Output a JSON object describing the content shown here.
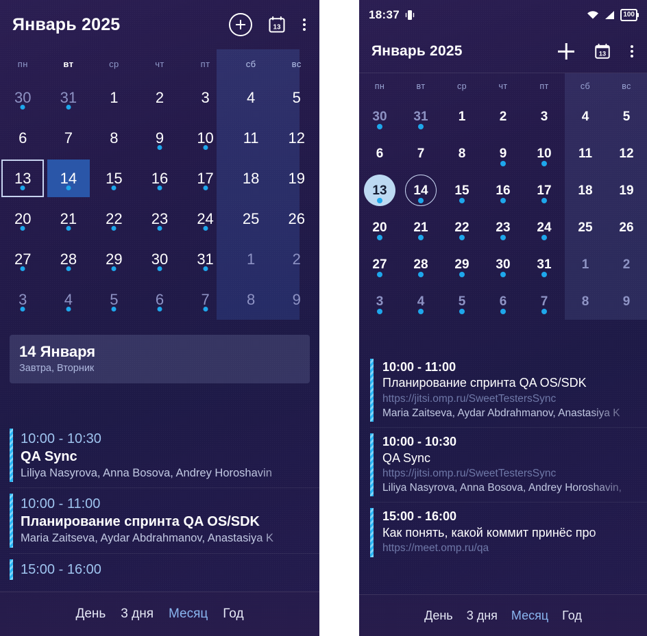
{
  "colors": {
    "background": "#241a4a",
    "accent": "#29b6f6",
    "event_dot": "#1ea7ec",
    "selected_fill": "#2a56a8",
    "today_circle": "#bcd9f2",
    "nav_active": "#8ab6f0"
  },
  "status_bar": {
    "time": "18:37",
    "vibrate_icon": "vibrate-icon",
    "wifi_icon": "wifi-icon",
    "signal_icon": "cellular-signal-icon",
    "battery_level": "100"
  },
  "app_bar": {
    "title": "Январь 2025",
    "add_icon": "plus-icon",
    "today_icon": "calendar-today-icon",
    "today_icon_label": "13",
    "overflow_icon": "more-vertical-icon"
  },
  "weekdays": [
    {
      "label": "пн",
      "weekend": false
    },
    {
      "label": "вт",
      "weekend": false
    },
    {
      "label": "ср",
      "weekend": false
    },
    {
      "label": "чт",
      "weekend": false
    },
    {
      "label": "пт",
      "weekend": false
    },
    {
      "label": "сб",
      "weekend": true
    },
    {
      "label": "вс",
      "weekend": true
    }
  ],
  "calendar": {
    "weeks": [
      [
        {
          "num": "30",
          "dim": true,
          "dot": true,
          "today": false,
          "selected": false
        },
        {
          "num": "31",
          "dim": true,
          "dot": true,
          "today": false,
          "selected": false
        },
        {
          "num": "1",
          "dim": false,
          "dot": false,
          "today": false,
          "selected": false
        },
        {
          "num": "2",
          "dim": false,
          "dot": false,
          "today": false,
          "selected": false
        },
        {
          "num": "3",
          "dim": false,
          "dot": false,
          "today": false,
          "selected": false
        },
        {
          "num": "4",
          "dim": false,
          "dot": false,
          "today": false,
          "selected": false
        },
        {
          "num": "5",
          "dim": false,
          "dot": false,
          "today": false,
          "selected": false
        }
      ],
      [
        {
          "num": "6",
          "dim": false,
          "dot": false,
          "today": false,
          "selected": false
        },
        {
          "num": "7",
          "dim": false,
          "dot": false,
          "today": false,
          "selected": false
        },
        {
          "num": "8",
          "dim": false,
          "dot": false,
          "today": false,
          "selected": false
        },
        {
          "num": "9",
          "dim": false,
          "dot": true,
          "today": false,
          "selected": false
        },
        {
          "num": "10",
          "dim": false,
          "dot": true,
          "today": false,
          "selected": false
        },
        {
          "num": "11",
          "dim": false,
          "dot": false,
          "today": false,
          "selected": false
        },
        {
          "num": "12",
          "dim": false,
          "dot": false,
          "today": false,
          "selected": false
        }
      ],
      [
        {
          "num": "13",
          "dim": false,
          "dot": true,
          "today": true,
          "selected": false
        },
        {
          "num": "14",
          "dim": false,
          "dot": true,
          "today": false,
          "selected": true
        },
        {
          "num": "15",
          "dim": false,
          "dot": true,
          "today": false,
          "selected": false
        },
        {
          "num": "16",
          "dim": false,
          "dot": true,
          "today": false,
          "selected": false
        },
        {
          "num": "17",
          "dim": false,
          "dot": true,
          "today": false,
          "selected": false
        },
        {
          "num": "18",
          "dim": false,
          "dot": false,
          "today": false,
          "selected": false
        },
        {
          "num": "19",
          "dim": false,
          "dot": false,
          "today": false,
          "selected": false
        }
      ],
      [
        {
          "num": "20",
          "dim": false,
          "dot": true,
          "today": false,
          "selected": false
        },
        {
          "num": "21",
          "dim": false,
          "dot": true,
          "today": false,
          "selected": false
        },
        {
          "num": "22",
          "dim": false,
          "dot": true,
          "today": false,
          "selected": false
        },
        {
          "num": "23",
          "dim": false,
          "dot": true,
          "today": false,
          "selected": false
        },
        {
          "num": "24",
          "dim": false,
          "dot": true,
          "today": false,
          "selected": false
        },
        {
          "num": "25",
          "dim": false,
          "dot": false,
          "today": false,
          "selected": false
        },
        {
          "num": "26",
          "dim": false,
          "dot": false,
          "today": false,
          "selected": false
        }
      ],
      [
        {
          "num": "27",
          "dim": false,
          "dot": true,
          "today": false,
          "selected": false
        },
        {
          "num": "28",
          "dim": false,
          "dot": true,
          "today": false,
          "selected": false
        },
        {
          "num": "29",
          "dim": false,
          "dot": true,
          "today": false,
          "selected": false
        },
        {
          "num": "30",
          "dim": false,
          "dot": true,
          "today": false,
          "selected": false
        },
        {
          "num": "31",
          "dim": false,
          "dot": true,
          "today": false,
          "selected": false
        },
        {
          "num": "1",
          "dim": true,
          "dot": false,
          "today": false,
          "selected": false
        },
        {
          "num": "2",
          "dim": true,
          "dot": false,
          "today": false,
          "selected": false
        }
      ],
      [
        {
          "num": "3",
          "dim": true,
          "dot": true,
          "today": false,
          "selected": false
        },
        {
          "num": "4",
          "dim": true,
          "dot": true,
          "today": false,
          "selected": false
        },
        {
          "num": "5",
          "dim": true,
          "dot": true,
          "today": false,
          "selected": false
        },
        {
          "num": "6",
          "dim": true,
          "dot": true,
          "today": false,
          "selected": false
        },
        {
          "num": "7",
          "dim": true,
          "dot": true,
          "today": false,
          "selected": false
        },
        {
          "num": "8",
          "dim": true,
          "dot": false,
          "today": false,
          "selected": false
        },
        {
          "num": "9",
          "dim": true,
          "dot": false,
          "today": false,
          "selected": false
        }
      ]
    ]
  },
  "day_card": {
    "title": "14 Января",
    "subtitle": "Завтра, Вторник"
  },
  "left_events": [
    {
      "time": "10:00 - 10:30",
      "title": "QA Sync",
      "people": "Liliya Nasyrova, Anna Bosova, Andrey Horoshavin"
    },
    {
      "time": "10:00 - 11:00",
      "title": "Планирование спринта QA OS/SDK",
      "people": "Maria Zaitseva, Aydar Abdrahmanov, Anastasiya K"
    },
    {
      "time": "15:00 - 16:00",
      "title": "",
      "people": ""
    }
  ],
  "right_events": [
    {
      "time": "10:00 - 11:00",
      "title": "Планирование спринта QA OS/SDK",
      "url": "https://jitsi.omp.ru/SweetTestersSync",
      "people": "Maria Zaitseva, Aydar Abdrahmanov, Anastasiya K"
    },
    {
      "time": "10:00 - 10:30",
      "title": "QA Sync",
      "url": "https://jitsi.omp.ru/SweetTestersSync",
      "people": "Liliya Nasyrova, Anna Bosova, Andrey Horoshavin,"
    },
    {
      "time": "15:00 - 16:00",
      "title": "Как понять, какой коммит принёс про",
      "url": "https://meet.omp.ru/qa",
      "people": ""
    }
  ],
  "bottom_nav": [
    {
      "label": "День",
      "active": false
    },
    {
      "label": "3 дня",
      "active": false
    },
    {
      "label": "Месяц",
      "active": true
    },
    {
      "label": "Год",
      "active": false
    }
  ]
}
